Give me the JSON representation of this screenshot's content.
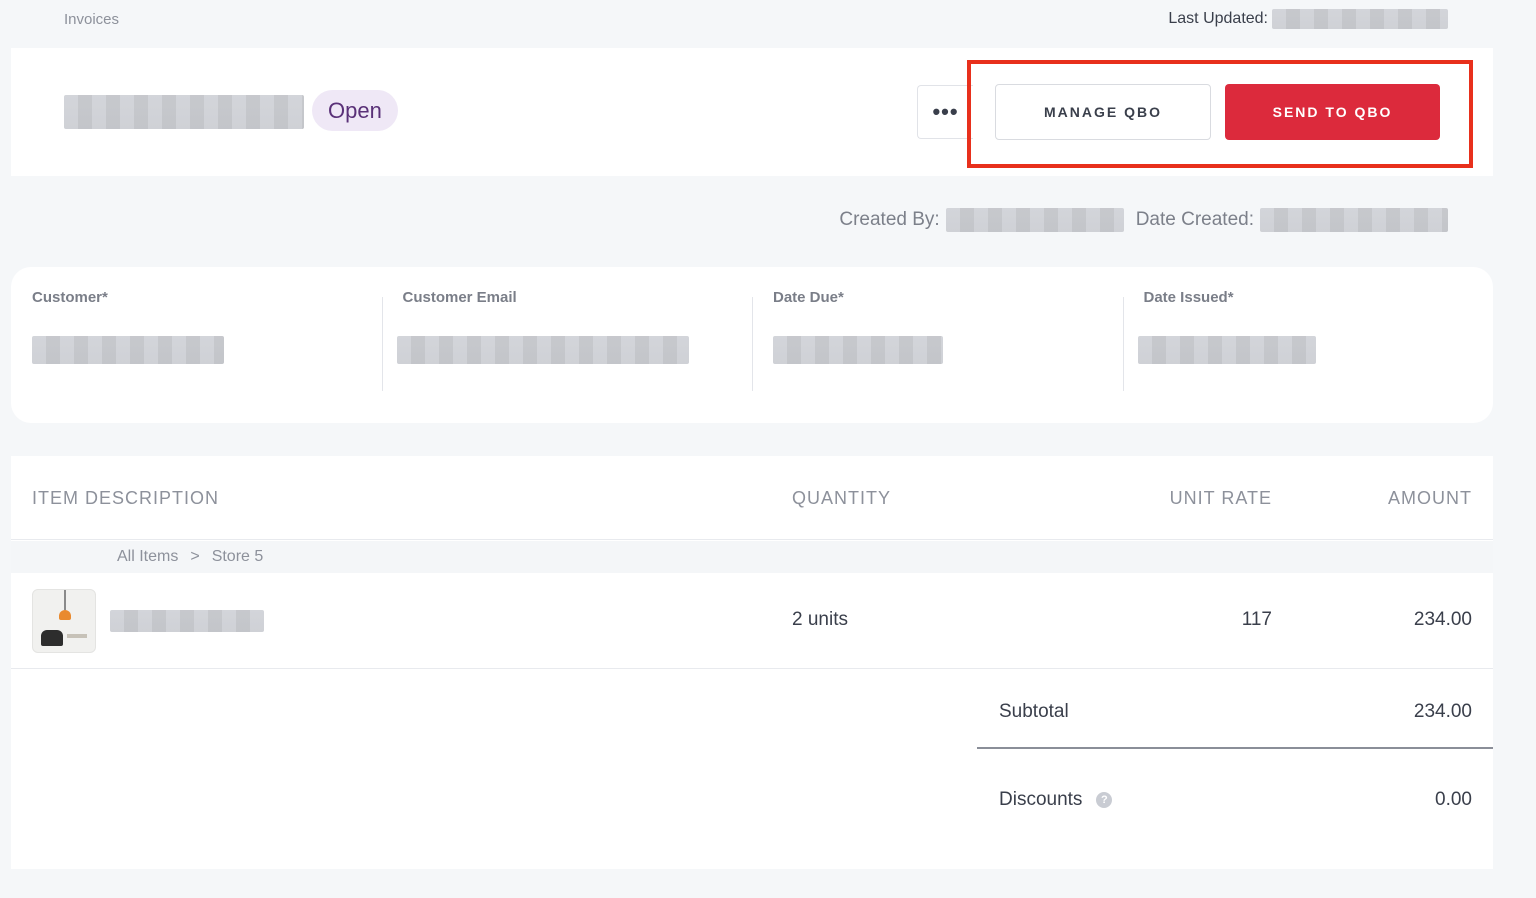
{
  "top": {
    "breadcrumb": "Invoices",
    "last_updated_label": "Last Updated:"
  },
  "header": {
    "status": "Open",
    "more_label": "•••",
    "manage_label": "MANAGE QBO",
    "send_label": "SEND TO QBO"
  },
  "meta": {
    "created_by_label": "Created By:",
    "date_created_label": "Date Created:"
  },
  "customer": {
    "fields": [
      {
        "label": "Customer*"
      },
      {
        "label": "Customer Email"
      },
      {
        "label": "Date Due*"
      },
      {
        "label": "Date Issued*"
      }
    ]
  },
  "table": {
    "headers": {
      "description": "ITEM DESCRIPTION",
      "quantity": "QUANTITY",
      "unit_rate": "UNIT RATE",
      "amount": "AMOUNT"
    },
    "sub_breadcrumb": {
      "root": "All Items",
      "separator": ">",
      "current": "Store 5"
    },
    "rows": [
      {
        "quantity": "2 units",
        "unit_rate": "117",
        "amount": "234.00"
      }
    ]
  },
  "totals": {
    "subtotal_label": "Subtotal",
    "subtotal_value": "234.00",
    "discounts_label": "Discounts",
    "discounts_help": "?",
    "discounts_value": "0.00"
  },
  "colors": {
    "accent": "#dc2a3c",
    "highlight": "#e8301c",
    "status_bg": "#efe8f6",
    "status_text": "#5a3178"
  }
}
